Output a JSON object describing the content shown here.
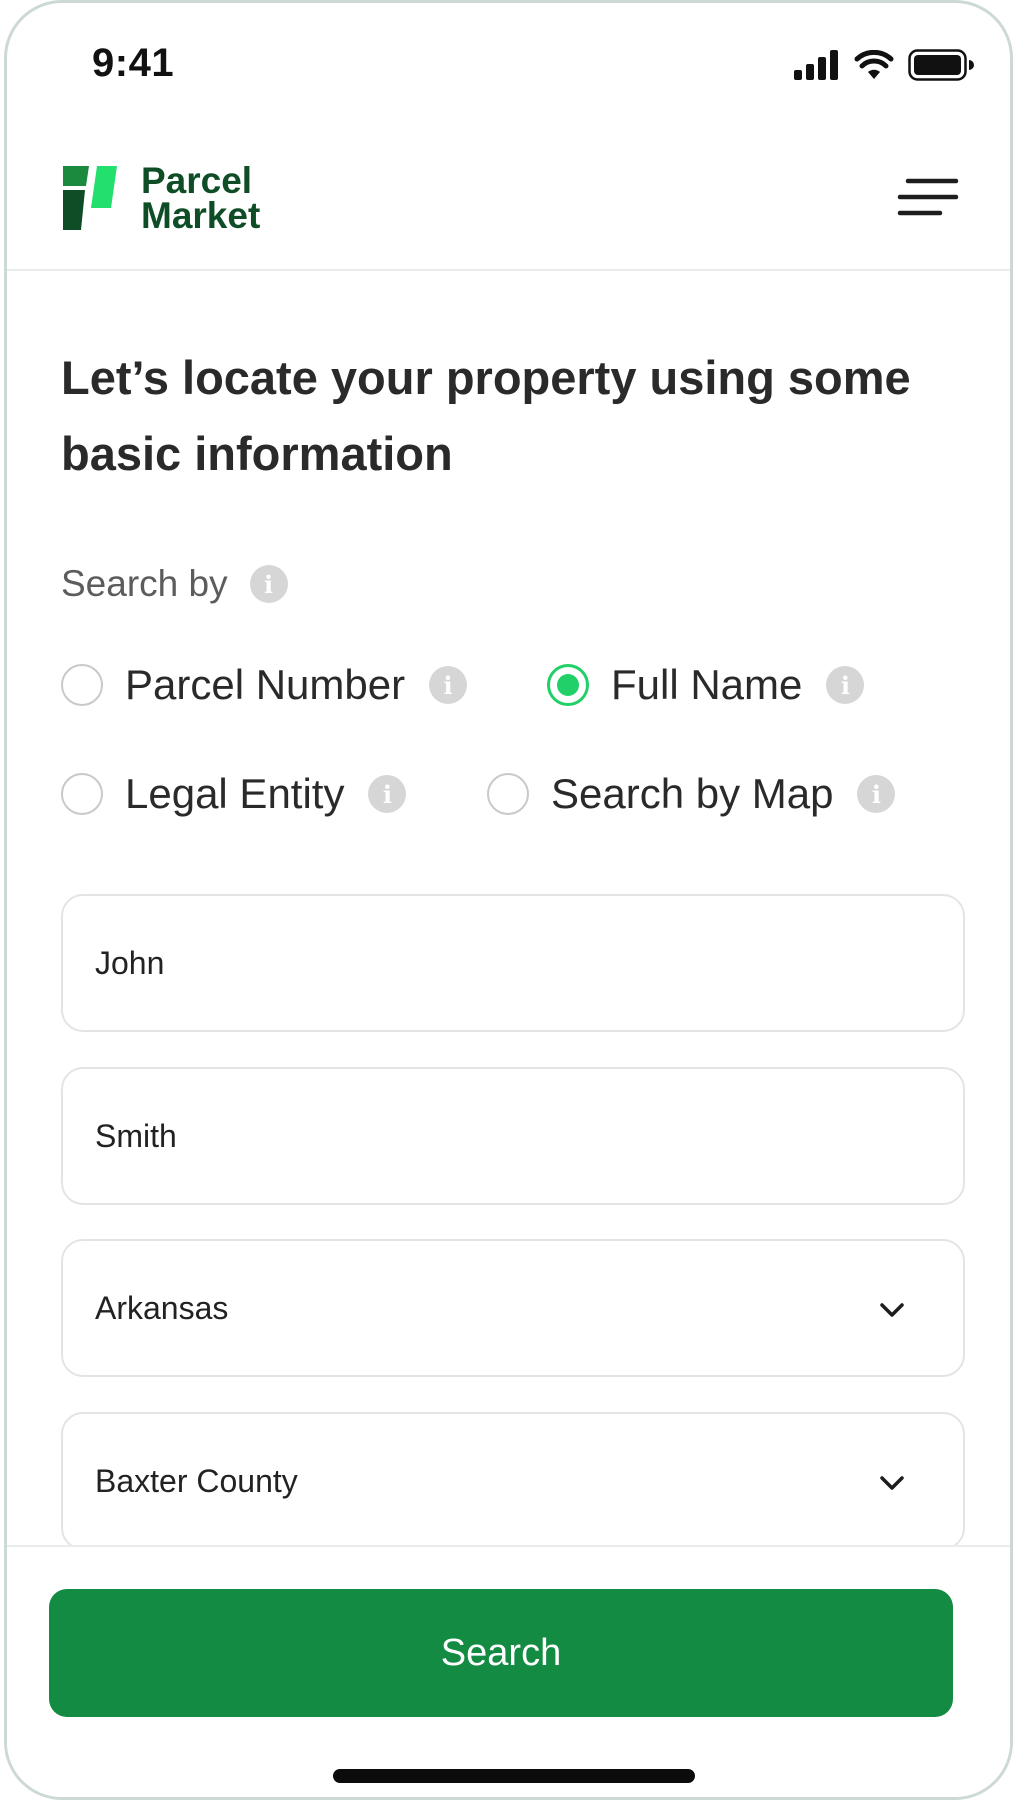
{
  "status_bar": {
    "time": "9:41"
  },
  "brand": {
    "line1": "Parcel",
    "line2": "Market"
  },
  "icons": {
    "menu": "hamburger-menu-icon",
    "info": "info-icon",
    "chevron": "chevron-down-icon",
    "signal": "cellular-signal-icon",
    "wifi": "wifi-icon",
    "battery": "battery-icon"
  },
  "colors": {
    "brand_dark": "#0e4d26",
    "brand_light": "#22d06a",
    "button": "#138b42"
  },
  "page": {
    "title": "Let’s locate your property using some basic information"
  },
  "search_by": {
    "label": "Search by",
    "info_glyph": "i",
    "options": [
      {
        "label": "Parcel Number",
        "selected": false
      },
      {
        "label": "Full Name",
        "selected": true
      },
      {
        "label": "Legal Entity",
        "selected": false
      },
      {
        "label": "Search by Map",
        "selected": false
      }
    ]
  },
  "form": {
    "first_name": "John",
    "last_name": "Smith",
    "state": "Arkansas",
    "county": "Baxter County"
  },
  "actions": {
    "search_label": "Search"
  }
}
